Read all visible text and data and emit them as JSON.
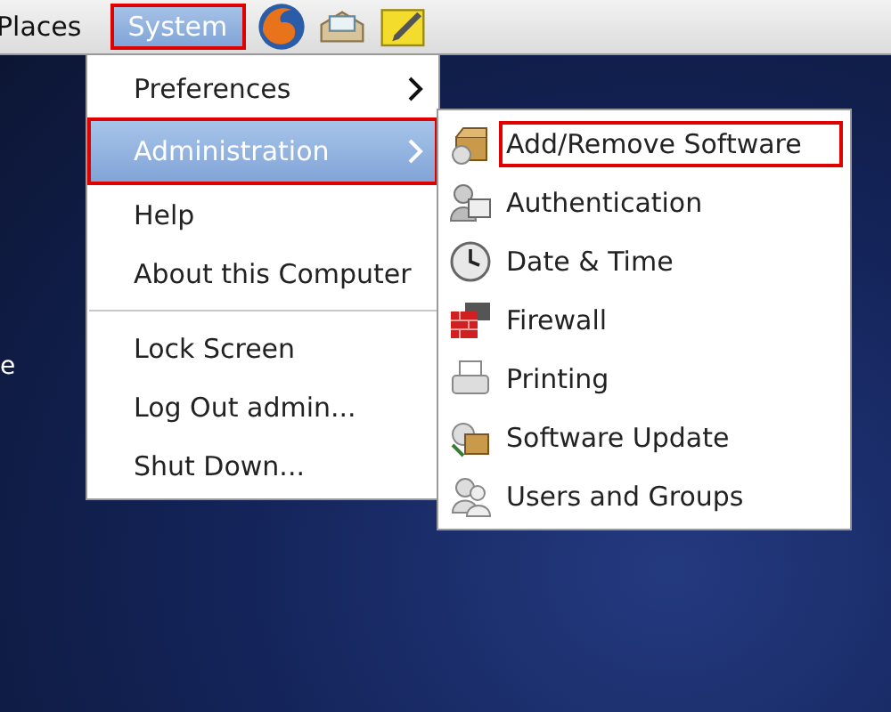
{
  "panel": {
    "menus": [
      {
        "label": "Places",
        "selected": false,
        "annotated": false
      },
      {
        "label": "System",
        "selected": true,
        "annotated": true
      }
    ],
    "launchers": [
      {
        "kind": "browser"
      },
      {
        "kind": "mail"
      },
      {
        "kind": "notes"
      }
    ]
  },
  "desktop": {
    "icon_label": "e"
  },
  "system_menu": {
    "groups": [
      [
        {
          "label": "Preferences",
          "submenu": true,
          "selected": false,
          "annotated": false
        },
        {
          "label": "Administration",
          "submenu": true,
          "selected": true,
          "annotated": true
        },
        {
          "label": "Help",
          "submenu": false,
          "selected": false,
          "annotated": false
        },
        {
          "label": "About this Computer",
          "submenu": false,
          "selected": false,
          "annotated": false
        }
      ],
      [
        {
          "label": "Lock Screen",
          "submenu": false,
          "selected": false,
          "annotated": false
        },
        {
          "label": "Log Out admin...",
          "submenu": false,
          "selected": false,
          "annotated": false
        },
        {
          "label": "Shut Down...",
          "submenu": false,
          "selected": false,
          "annotated": false
        }
      ]
    ]
  },
  "administration_menu": {
    "items": [
      {
        "label": "Add/Remove Software",
        "kind": "package",
        "selected": false,
        "annotated": true
      },
      {
        "label": "Authentication",
        "kind": "user-card",
        "selected": false,
        "annotated": false
      },
      {
        "label": "Date & Time",
        "kind": "clock",
        "selected": false,
        "annotated": false
      },
      {
        "label": "Firewall",
        "kind": "brick-wall",
        "selected": false,
        "annotated": false
      },
      {
        "label": "Printing",
        "kind": "printer",
        "selected": false,
        "annotated": false
      },
      {
        "label": "Software Update",
        "kind": "package-update",
        "selected": false,
        "annotated": false
      },
      {
        "label": "Users and Groups",
        "kind": "users",
        "selected": false,
        "annotated": false
      }
    ]
  }
}
